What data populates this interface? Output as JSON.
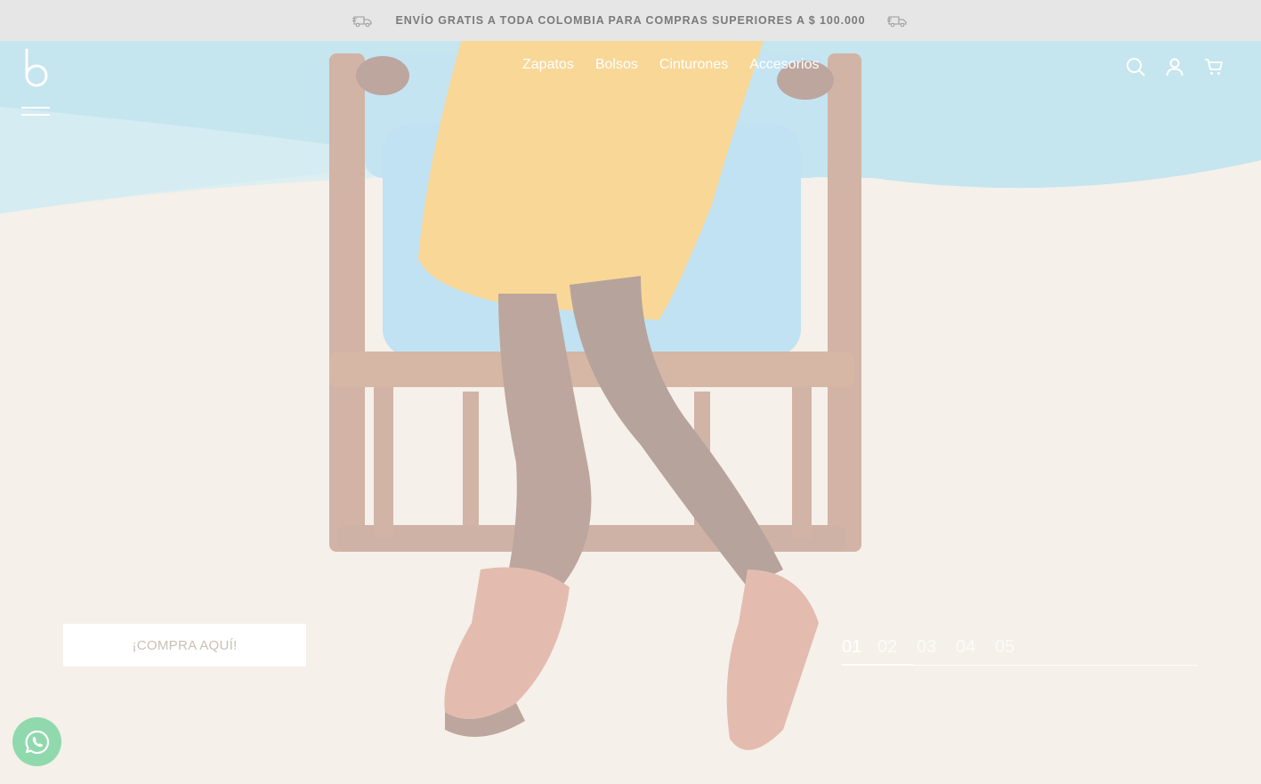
{
  "announcement": {
    "text": "ENVÍO GRATIS A TODA COLOMBIA PARA COMPRAS SUPERIORES A $ 100.000",
    "left_icon": "delivery-truck-icon",
    "right_icon": "delivery-truck-icon"
  },
  "header": {
    "logo_icon": "b-logo-icon",
    "menu_icon": "hamburger-menu-icon",
    "nav": [
      {
        "label": "Zapatos"
      },
      {
        "label": "Bolsos"
      },
      {
        "label": "Cinturones"
      },
      {
        "label": "Accesorios"
      }
    ],
    "icons": [
      "search-icon",
      "user-icon",
      "cart-icon"
    ]
  },
  "hero": {
    "cta_label": "¡COMPRA AQUÍ!",
    "slides": [
      "01",
      "02",
      "03",
      "04",
      "05"
    ],
    "active_slide": "01"
  },
  "whatsapp": {
    "icon": "whatsapp-icon"
  },
  "colors": {
    "announcement_bg": "#e6e6e6",
    "announcement_text": "#7a7a7a",
    "nav_text": "#ffffff",
    "cta_bg": "#ffffff",
    "cta_text": "#c9c0b4",
    "whatsapp_bg": "#8fd9ad"
  }
}
